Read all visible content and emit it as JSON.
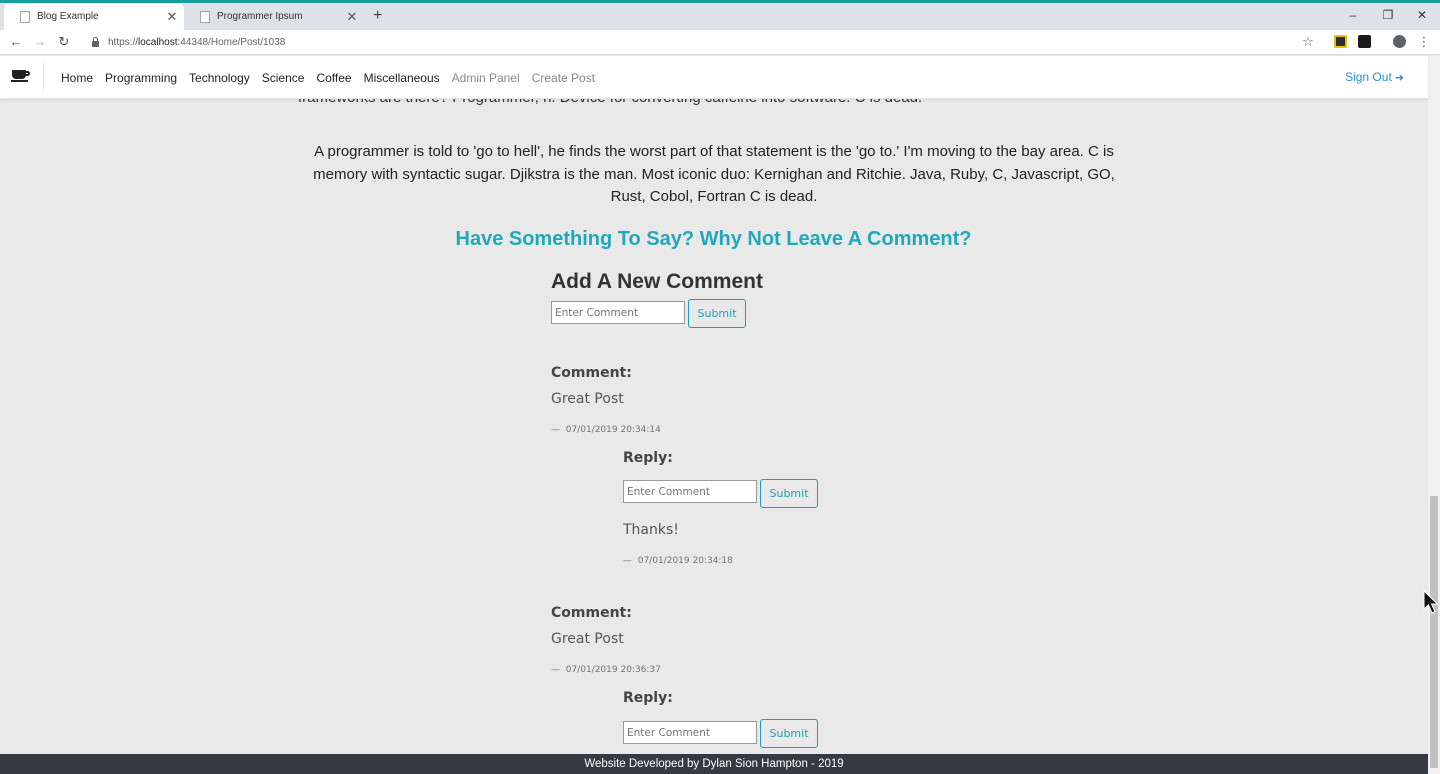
{
  "browser": {
    "tabs": [
      {
        "title": "Blog Example",
        "active": true
      },
      {
        "title": "Programmer Ipsum",
        "active": false
      }
    ],
    "new_tab": "+",
    "window_controls": {
      "minimize": "–",
      "restore": "❐",
      "close": "✕"
    },
    "url_prefix": "https://",
    "url_host": "localhost",
    "url_rest": ":44348/Home/Post/1038",
    "icons": {
      "back": "back-arrow-icon",
      "forward": "forward-arrow-icon",
      "reload": "reload-icon",
      "star": "bookmark-star-icon",
      "profile": "profile-icon",
      "menu": "menu-dots-icon"
    },
    "glyphs": {
      "back": "←",
      "forward": "→",
      "reload": "↻",
      "star": "☆",
      "menu": "⋮",
      "close": "✕"
    }
  },
  "navbar": {
    "links": [
      "Home",
      "Programming",
      "Technology",
      "Science",
      "Coffee",
      "Miscellaneous"
    ],
    "admin_links": [
      "Admin Panel",
      "Create Post"
    ],
    "signout": "Sign Out",
    "signout_glyph": "➜",
    "accent": "#2a8fd6"
  },
  "post": {
    "partial_line": "frameworks are there? Programmer, n. Device for converting caffeine into software. C is dead.",
    "paragraph": "A programmer is told to 'go to hell', he finds the worst part of that statement is the 'go to.' I'm moving to the bay area. C is memory with syntactic sugar. Djikstra is the man. Most iconic duo: Kernighan and Ritchie. Java, Ruby, C, Javascript, GO, Rust, Cobol, Fortran C is dead."
  },
  "comments_section": {
    "cta": "Have Something To Say? Why Not Leave A Comment?",
    "cta_color": "#20a8bb",
    "add_title": "Add A New Comment",
    "input_placeholder": "Enter Comment",
    "submit_label": "Submit",
    "comment_label": "Comment:",
    "reply_label": "Reply:",
    "dash": "—",
    "comments": [
      {
        "body": "Great Post",
        "timestamp": "07/01/2019 20:34:14",
        "replies": [
          {
            "body": "Thanks!",
            "timestamp": "07/01/2019 20:34:18"
          }
        ]
      },
      {
        "body": "Great Post",
        "timestamp": "07/01/2019 20:36:37",
        "replies": []
      }
    ]
  },
  "footer": {
    "text": "Website Developed by Dylan Sion Hampton - 2019",
    "bg": "#343a40"
  }
}
